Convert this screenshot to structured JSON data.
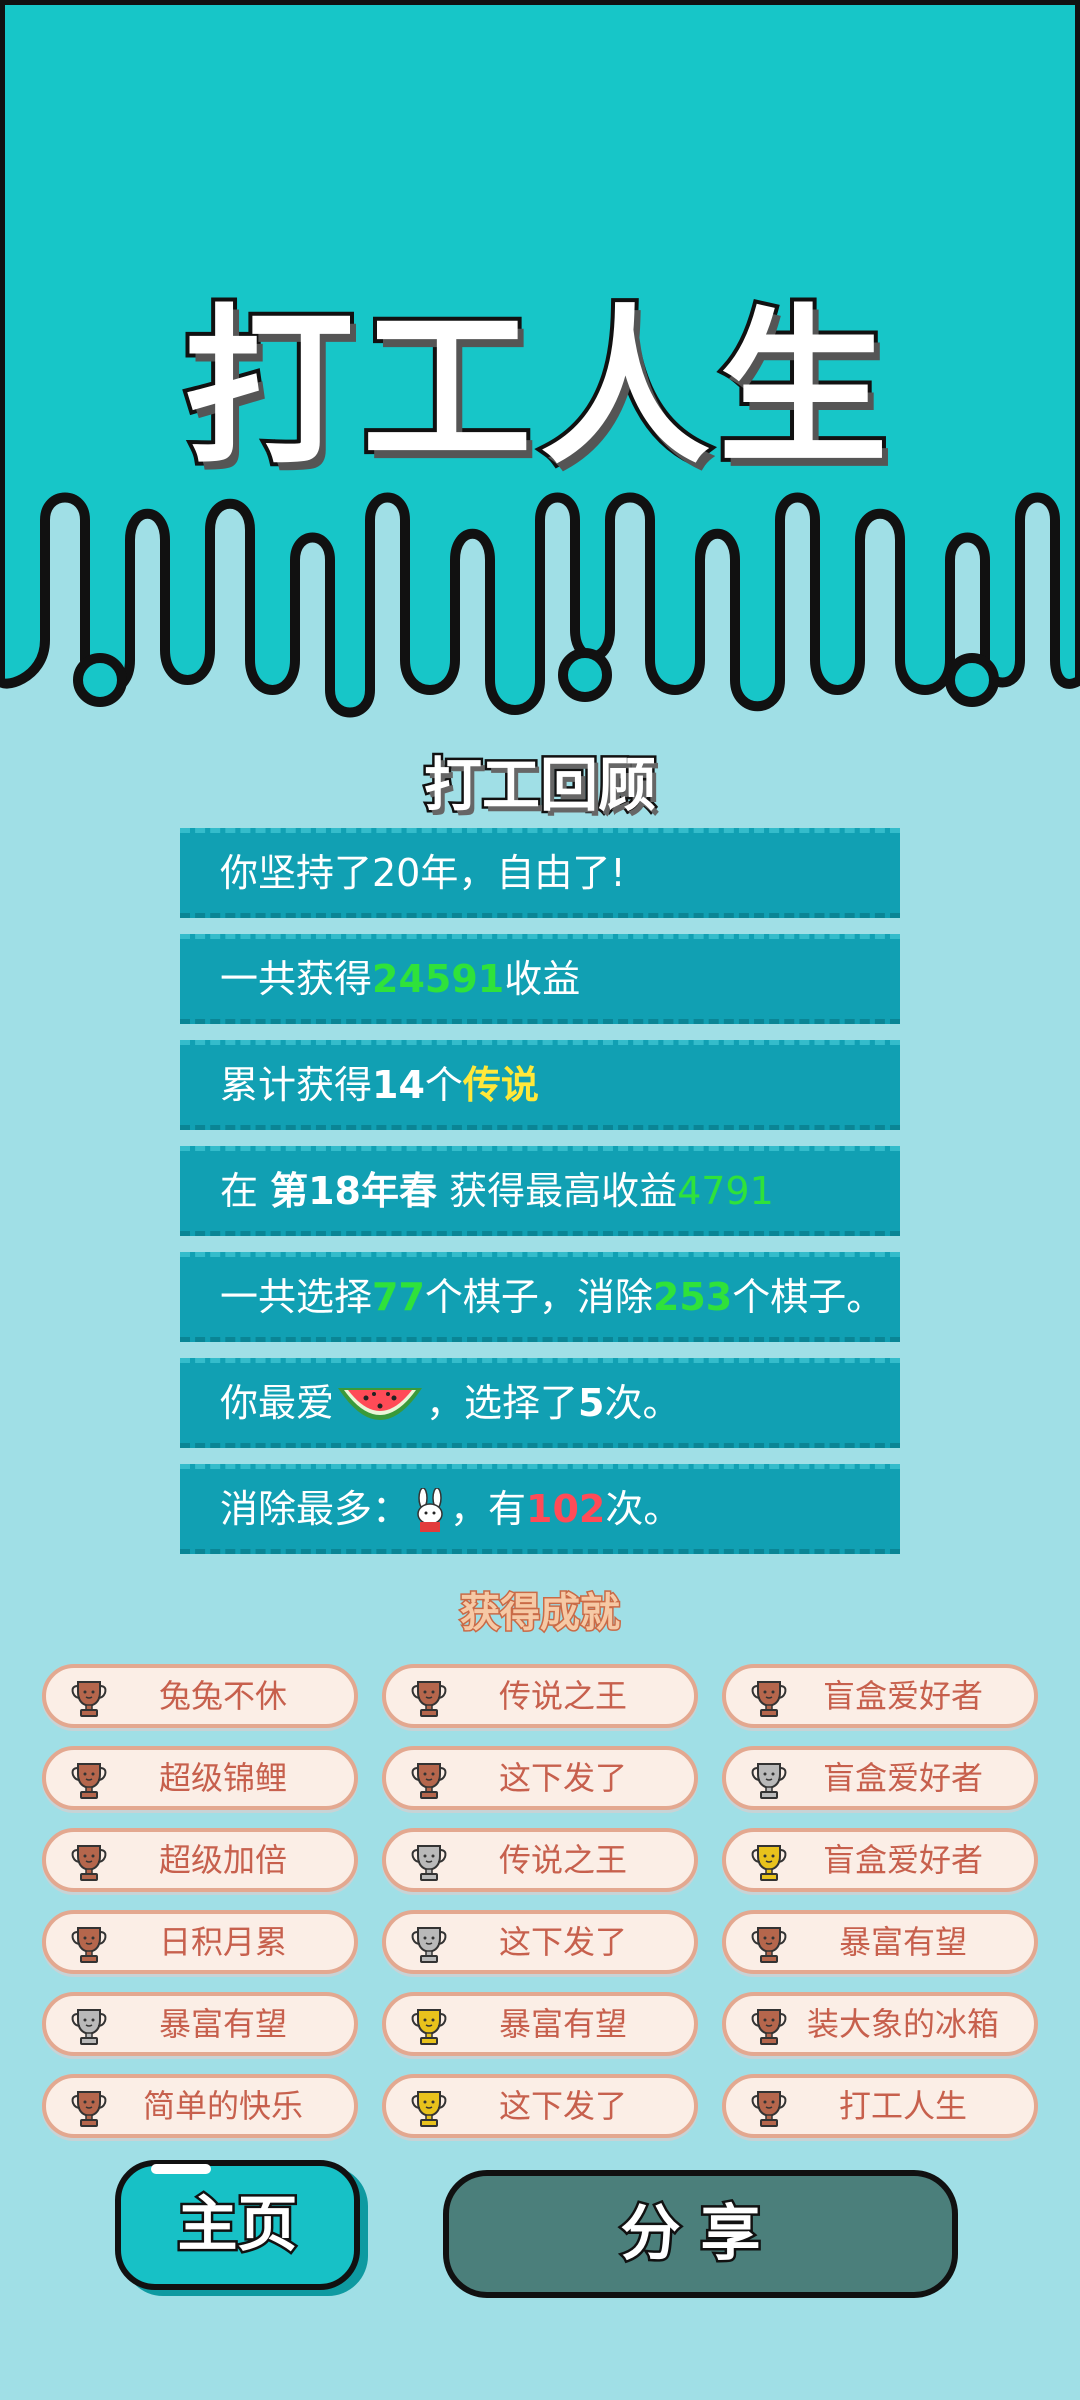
{
  "title": "打工人生",
  "review": {
    "heading": "打工回顾",
    "line1": "你坚持了20年，自由了!",
    "line2": {
      "pre": "一共获得",
      "value": "24591",
      "post": "收益"
    },
    "line3": {
      "pre": "累计获得",
      "count": "14",
      "mid": "个",
      "tag": "传说"
    },
    "line4": {
      "pre": "在 ",
      "season": "第18年春",
      "mid": " 获得最高收益",
      "value": "4791"
    },
    "line5": {
      "pre": "一共选择",
      "chosen": "77",
      "mid": "个棋子，消除",
      "removed": "253",
      "post": "个棋子。"
    },
    "line6": {
      "pre": "你最爱",
      "mid": "，选择了",
      "count": "5",
      "post": "次。"
    },
    "line7": {
      "pre": "消除最多：",
      "mid": "，有",
      "count": "102",
      "post": "次。"
    }
  },
  "achievements": {
    "heading": "获得成就",
    "items": [
      {
        "label": "兔兔不休",
        "tier": "bronze"
      },
      {
        "label": "传说之王",
        "tier": "bronze"
      },
      {
        "label": "盲盒爱好者",
        "tier": "bronze"
      },
      {
        "label": "超级锦鲤",
        "tier": "bronze"
      },
      {
        "label": "这下发了",
        "tier": "bronze"
      },
      {
        "label": "盲盒爱好者",
        "tier": "silver"
      },
      {
        "label": "超级加倍",
        "tier": "bronze"
      },
      {
        "label": "传说之王",
        "tier": "silver"
      },
      {
        "label": "盲盒爱好者",
        "tier": "gold"
      },
      {
        "label": "日积月累",
        "tier": "bronze"
      },
      {
        "label": "这下发了",
        "tier": "silver"
      },
      {
        "label": "暴富有望",
        "tier": "bronze"
      },
      {
        "label": "暴富有望",
        "tier": "silver"
      },
      {
        "label": "暴富有望",
        "tier": "gold"
      },
      {
        "label": "装大象的冰箱",
        "tier": "bronze"
      },
      {
        "label": "简单的快乐",
        "tier": "bronze"
      },
      {
        "label": "这下发了",
        "tier": "gold"
      },
      {
        "label": "打工人生",
        "tier": "bronze"
      }
    ]
  },
  "buttons": {
    "home": "主页",
    "share": "分享"
  },
  "colors": {
    "bg_top": "#17c6c8",
    "bg": "#a0dfe6",
    "row": "#11a0b3",
    "green": "#2fe23a",
    "yellow": "#ffe83a",
    "red": "#ff4b57",
    "bronze": "#b5664c",
    "silver": "#b9b9b9",
    "gold": "#e8c21c"
  }
}
